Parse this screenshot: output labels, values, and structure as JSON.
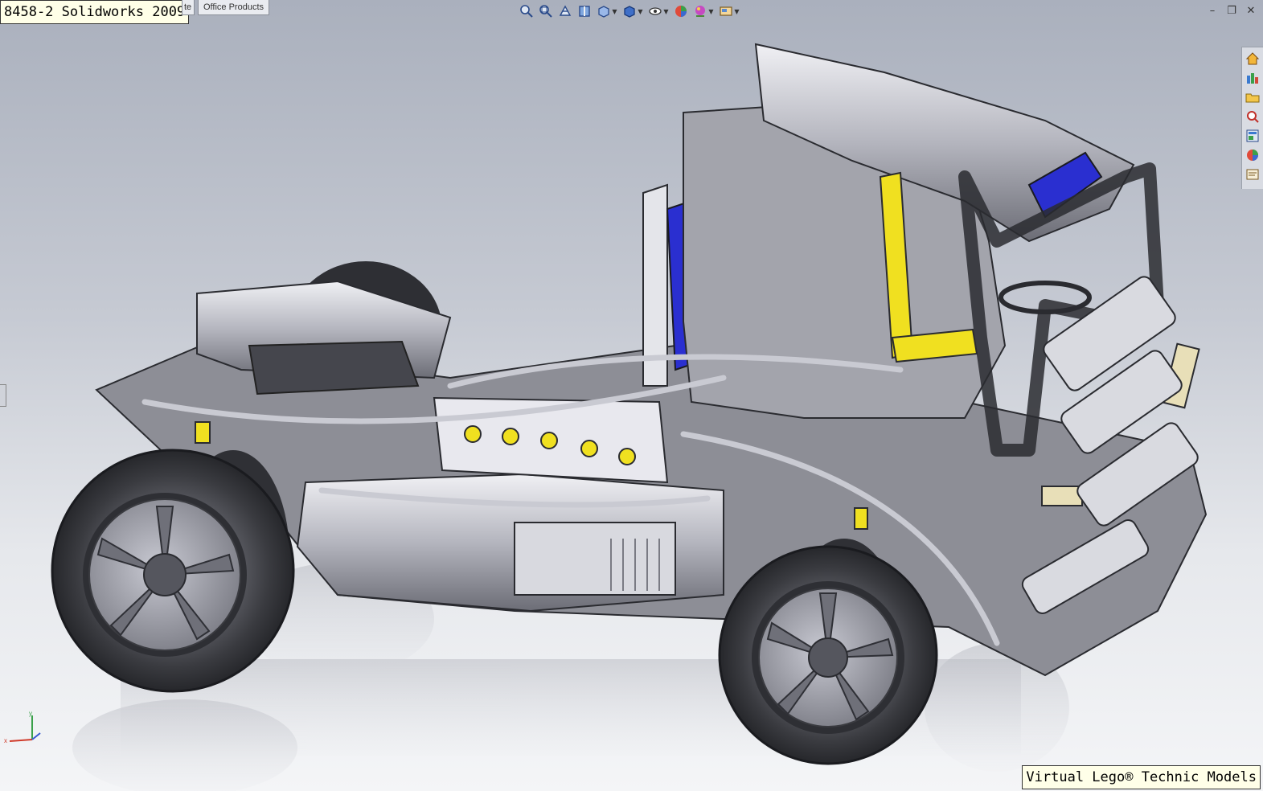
{
  "window": {
    "title_label": "8458-2 Solidworks 2009",
    "watermark": "Virtual Lego® Technic Models"
  },
  "command_manager": {
    "tabs": [
      {
        "label": "te"
      },
      {
        "label": "Office Products"
      }
    ]
  },
  "heads_up_toolbar": {
    "icons": [
      "zoom-to-fit-icon",
      "zoom-to-area-icon",
      "previous-view-icon",
      "section-view-icon",
      "view-orientation-icon",
      "display-style-icon",
      "hide-show-items-icon",
      "edit-appearance-icon",
      "apply-scene-icon",
      "view-settings-icon"
    ]
  },
  "task_pane": {
    "icons": [
      "solidworks-resources-icon",
      "design-library-icon",
      "file-explorer-icon",
      "search-icon",
      "view-palette-icon",
      "appearances-icon",
      "custom-properties-icon"
    ]
  },
  "colors": {
    "model_gray": "#9a9ba2",
    "model_dark": "#3c3d44",
    "accent_blue": "#2a2fd0",
    "accent_yellow": "#f0e020",
    "label_bg": "#ffffe8"
  }
}
